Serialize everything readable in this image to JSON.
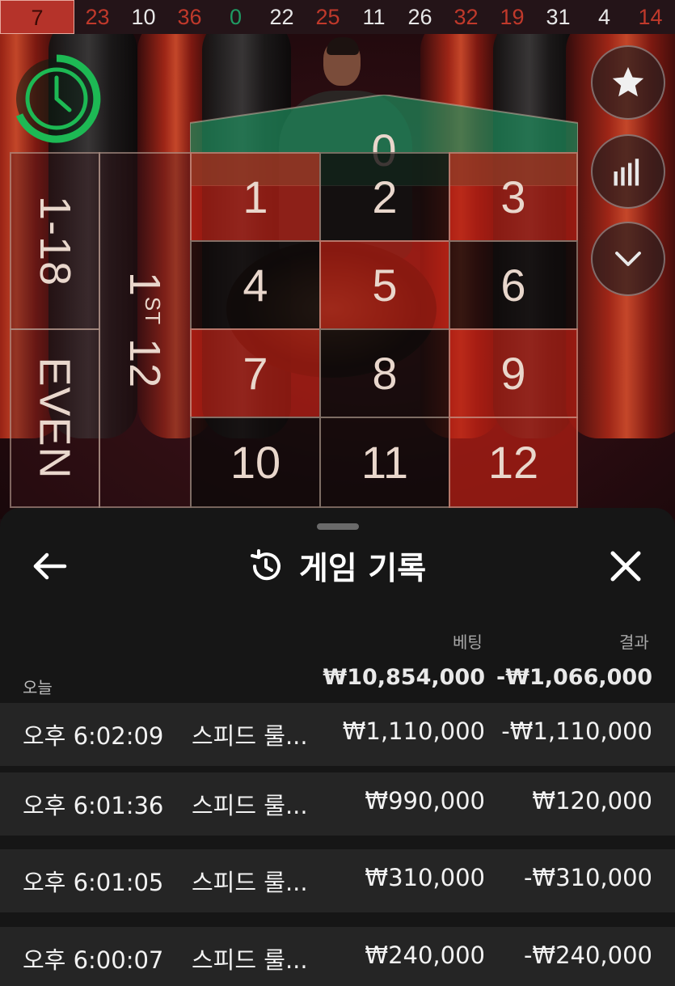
{
  "history_strip": {
    "current": "7",
    "items": [
      {
        "value": "23",
        "color": "red"
      },
      {
        "value": "10",
        "color": "black"
      },
      {
        "value": "36",
        "color": "red"
      },
      {
        "value": "0",
        "color": "green"
      },
      {
        "value": "22",
        "color": "black"
      },
      {
        "value": "25",
        "color": "red"
      },
      {
        "value": "11",
        "color": "black"
      },
      {
        "value": "26",
        "color": "black"
      },
      {
        "value": "32",
        "color": "red"
      },
      {
        "value": "19",
        "color": "red"
      },
      {
        "value": "31",
        "color": "black"
      },
      {
        "value": "4",
        "color": "black"
      },
      {
        "value": "14",
        "color": "red"
      }
    ]
  },
  "table": {
    "zero": "0",
    "low": "1-18",
    "even": "EVEN",
    "dozen_num": "1",
    "dozen_sup": "ST",
    "dozen_rest": " 12",
    "numbers": [
      {
        "n": "1",
        "color": "red"
      },
      {
        "n": "2",
        "color": "black"
      },
      {
        "n": "3",
        "color": "red"
      },
      {
        "n": "4",
        "color": "black"
      },
      {
        "n": "5",
        "color": "red"
      },
      {
        "n": "6",
        "color": "black"
      },
      {
        "n": "7",
        "color": "red"
      },
      {
        "n": "8",
        "color": "black"
      },
      {
        "n": "9",
        "color": "red"
      },
      {
        "n": "10",
        "color": "black"
      },
      {
        "n": "11",
        "color": "black"
      },
      {
        "n": "12",
        "color": "red"
      }
    ]
  },
  "controls": {
    "timer_icon": "clock-icon",
    "favorite_icon": "star-icon",
    "stats_icon": "bar-chart-icon",
    "collapse_icon": "chevron-down-icon"
  },
  "sheet": {
    "title": "게임 기록",
    "title_icon": "history-icon",
    "back_icon": "arrow-left-icon",
    "close_icon": "close-icon",
    "col_bet": "베팅",
    "col_result": "결과",
    "summary": {
      "label": "오늘",
      "bet": "₩10,854,000",
      "result": "-₩1,066,000"
    },
    "rows": [
      {
        "time": "오후 6:02:09",
        "game": "스피드 룰...",
        "bet": "₩1,110,000",
        "result": "-₩1,110,000"
      },
      {
        "time": "오후 6:01:36",
        "game": "스피드 룰...",
        "bet": "₩990,000",
        "result": "₩120,000"
      },
      {
        "time": "오후 6:01:05",
        "game": "스피드 룰...",
        "bet": "₩310,000",
        "result": "-₩310,000"
      },
      {
        "time": "오후 6:00:07",
        "game": "스피드 룰...",
        "bet": "₩240,000",
        "result": "-₩240,000"
      }
    ]
  },
  "colors": {
    "timer_green": "#1db954",
    "red_cell": "#b41e14",
    "green_zero": "#1f8a5c",
    "sheet_bg": "#161616",
    "row_bg": "#252525"
  }
}
